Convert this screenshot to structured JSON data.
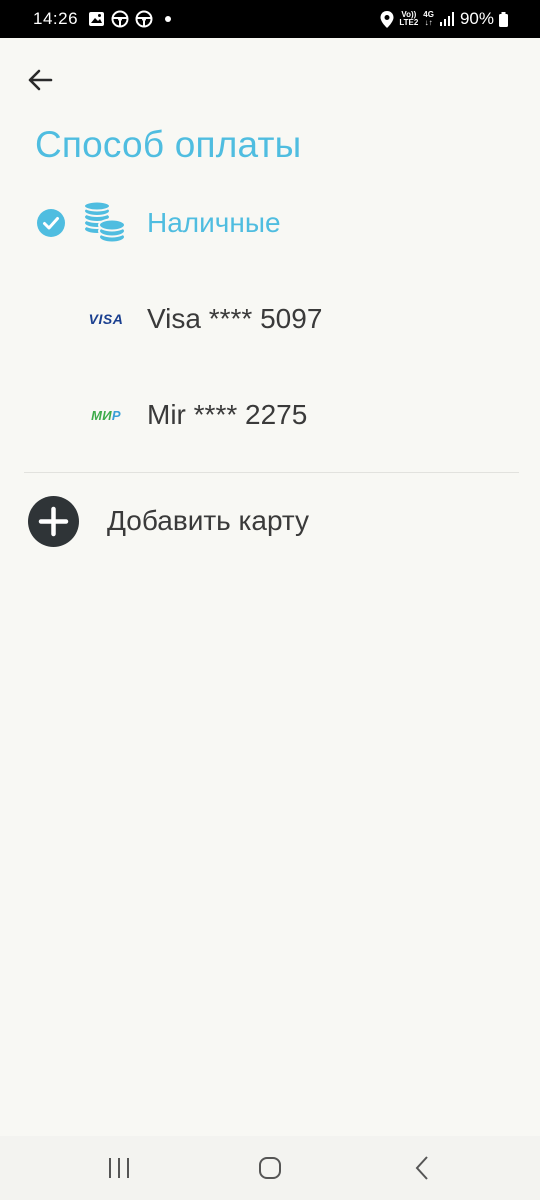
{
  "status_bar": {
    "time": "14:26",
    "network_top": "Vo))",
    "network_bottom": "LTE2",
    "network_gen": "4G",
    "battery": "90%",
    "icons": [
      "gallery-icon",
      "steering-wheel-icon",
      "steering-wheel-icon",
      "dot-icon",
      "location-icon",
      "signal-icon",
      "battery-icon"
    ]
  },
  "header": {
    "back_icon": "arrow-left-icon",
    "title": "Способ оплаты"
  },
  "payment_methods": [
    {
      "label": "Наличные",
      "icon": "coins-icon",
      "selected": true
    },
    {
      "label": "Visa **** 5097",
      "icon": "visa-logo",
      "logo_text": "VISA",
      "selected": false
    },
    {
      "label": "Mir **** 2275",
      "icon": "mir-logo",
      "logo_text_a": "МИ",
      "logo_text_b": "Р",
      "selected": false
    }
  ],
  "add_card": {
    "label": "Добавить карту",
    "icon": "plus-circle-icon"
  },
  "nav_bar": {
    "buttons": [
      "recents-icon",
      "home-icon",
      "back-icon"
    ]
  },
  "colors": {
    "accent": "#4fbde0",
    "text": "#3a3a3a",
    "background": "#f8f8f4",
    "dark_icon": "#2f3437"
  }
}
